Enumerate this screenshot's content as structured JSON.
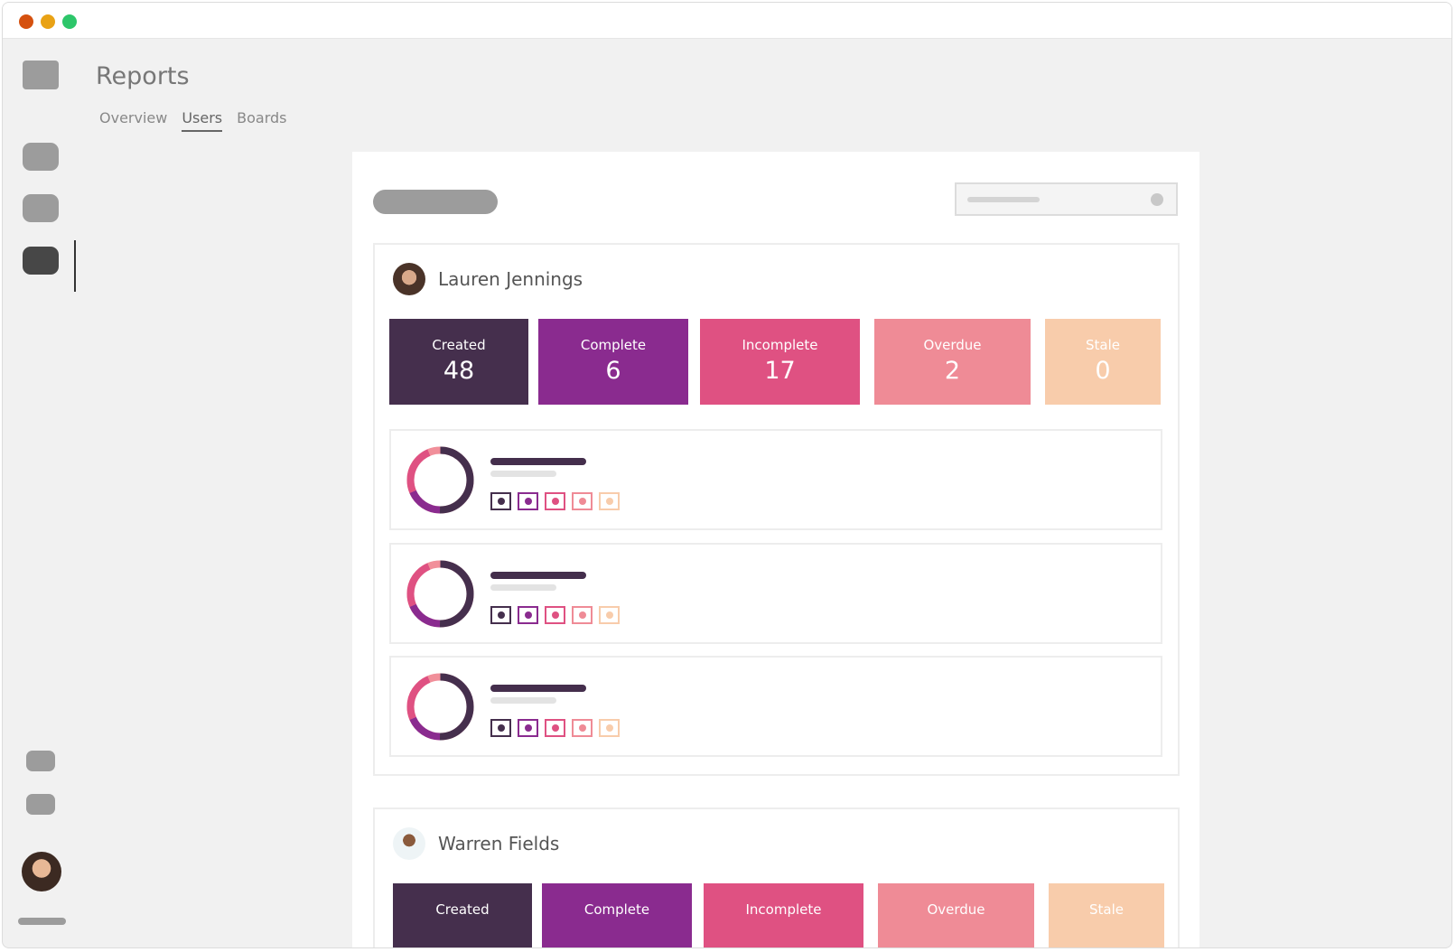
{
  "window": {
    "controls": [
      "close",
      "minimize",
      "maximize"
    ]
  },
  "header": {
    "title": "Reports"
  },
  "tabs": [
    {
      "label": "Overview",
      "active": false
    },
    {
      "label": "Users",
      "active": true
    },
    {
      "label": "Boards",
      "active": false
    }
  ],
  "colors": {
    "created": "#452f4d",
    "complete": "#8a2b8f",
    "incomplete": "#df5182",
    "overdue": "#ef8b96",
    "stale": "#f8ccab"
  },
  "users": [
    {
      "name": "Lauren Jennings",
      "stats": [
        {
          "label": "Created",
          "value": "48"
        },
        {
          "label": "Complete",
          "value": "6"
        },
        {
          "label": "Incomplete",
          "value": "17"
        },
        {
          "label": "Overdue",
          "value": "2"
        },
        {
          "label": "Stale",
          "value": "0"
        }
      ]
    },
    {
      "name": "Warren Fields",
      "stats": [
        {
          "label": "Created"
        },
        {
          "label": "Complete"
        },
        {
          "label": "Incomplete"
        },
        {
          "label": "Overdue"
        },
        {
          "label": "Stale"
        }
      ]
    }
  ]
}
